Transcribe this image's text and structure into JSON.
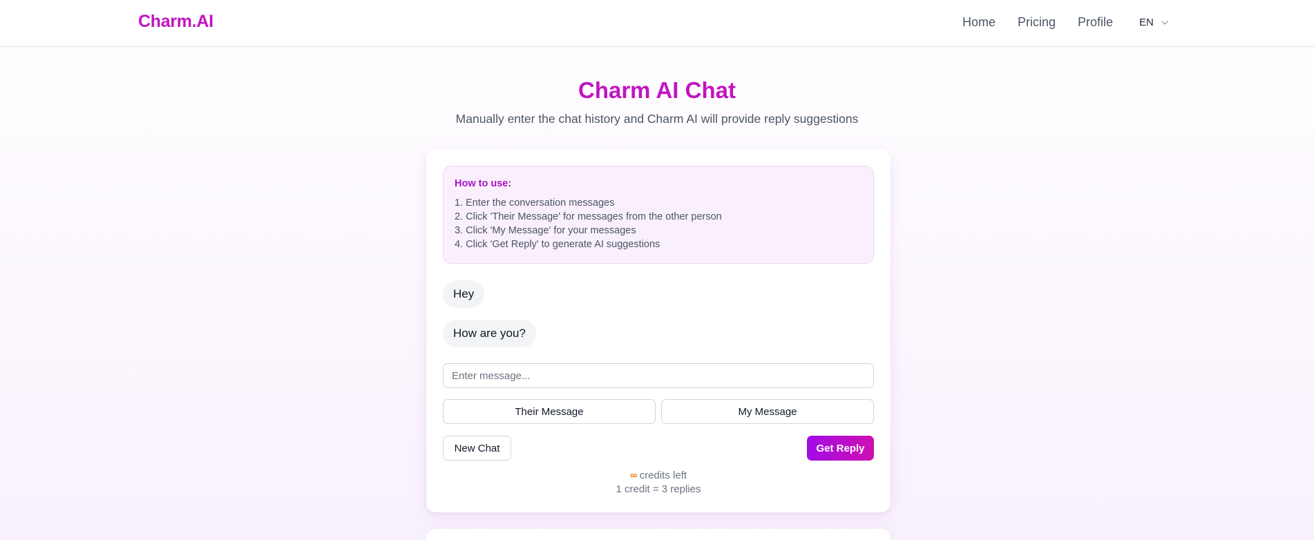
{
  "nav": {
    "logo": "Charm.AI",
    "links": [
      "Home",
      "Pricing",
      "Profile"
    ],
    "language": "EN"
  },
  "header": {
    "title": "Charm AI Chat",
    "subtitle": "Manually enter the chat history and Charm AI will provide reply suggestions"
  },
  "howto": {
    "title": "How to use:",
    "steps": [
      "1. Enter the conversation messages",
      "2. Click 'Their Message' for messages from the other person",
      "3. Click 'My Message' for your messages",
      "4. Click 'Get Reply' to generate AI suggestions"
    ]
  },
  "messages": [
    "Hey",
    "How are you?"
  ],
  "composer": {
    "placeholder": "Enter message...",
    "their_label": "Their Message",
    "my_label": "My Message",
    "new_chat_label": "New Chat",
    "get_reply_label": "Get Reply"
  },
  "credits": {
    "symbol": "∞",
    "left_text": "credits left",
    "rate_text": "1 credit = 3 replies"
  },
  "colors": {
    "brand": "#c114c1",
    "accent_gradient_start": "#a10ce6",
    "accent_gradient_end": "#cf0fb1",
    "credit_symbol": "#f07b1a"
  }
}
